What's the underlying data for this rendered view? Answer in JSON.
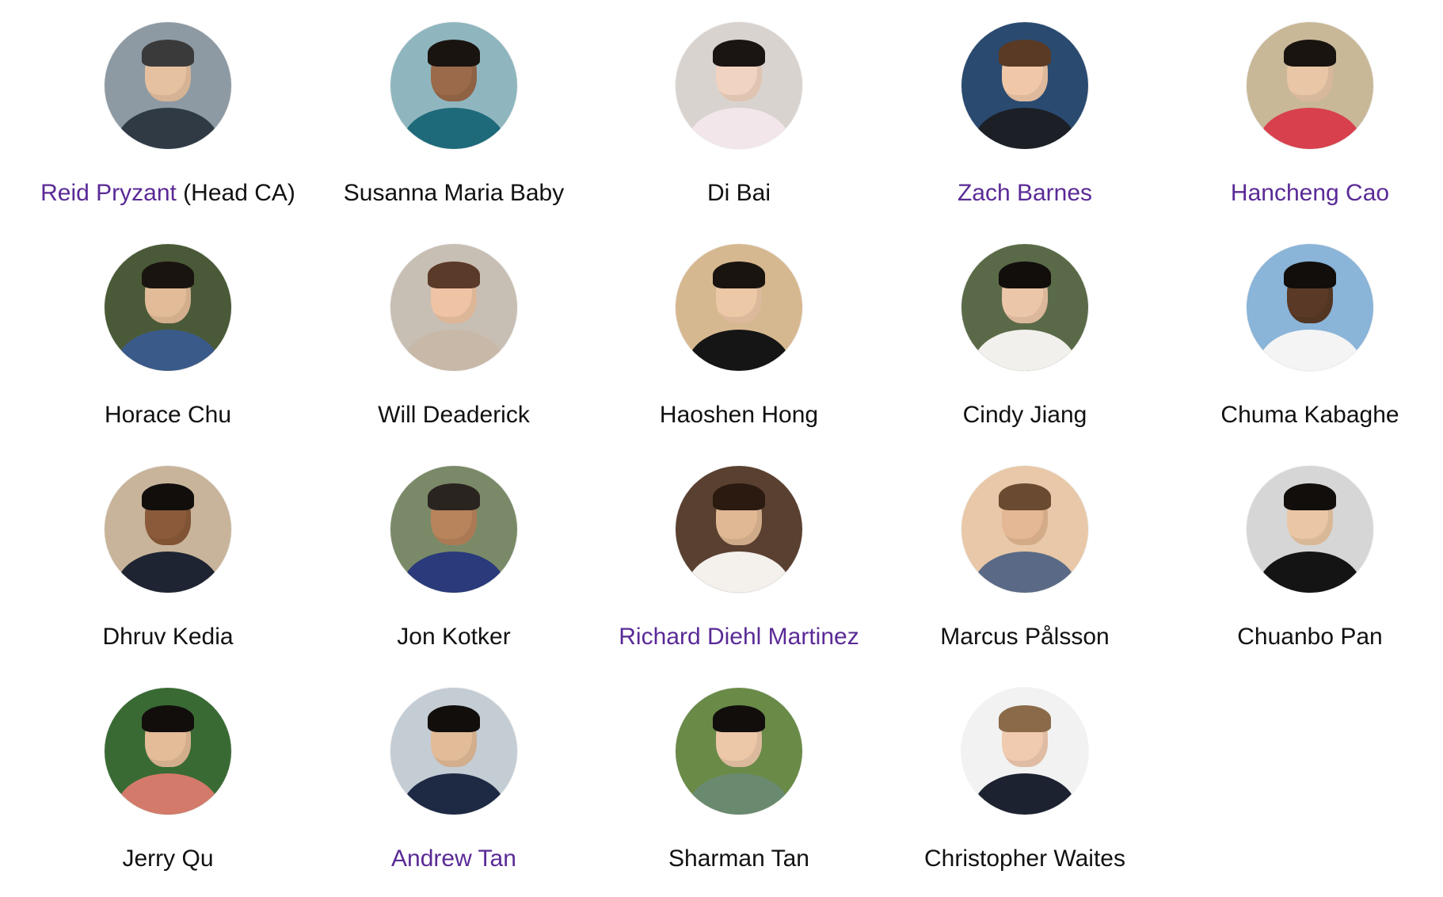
{
  "people": [
    {
      "name": "Reid Pryzant",
      "suffix": " (Head CA)",
      "linked": true,
      "colors": {
        "bg": "#8e9aa3",
        "skin": "#e6c1a0",
        "hair": "#3a3a3a",
        "body": "#2f3a44"
      }
    },
    {
      "name": "Susanna Maria Baby",
      "suffix": "",
      "linked": false,
      "colors": {
        "bg": "#8fb6bf",
        "skin": "#9a6a4a",
        "hair": "#1a1410",
        "body": "#1e6a7a"
      }
    },
    {
      "name": "Di Bai",
      "suffix": "",
      "linked": false,
      "colors": {
        "bg": "#d9d3cf",
        "skin": "#f0d3c0",
        "hair": "#1a1412",
        "body": "#f2e6ea"
      }
    },
    {
      "name": "Zach Barnes",
      "suffix": "",
      "linked": true,
      "colors": {
        "bg": "#2a4a70",
        "skin": "#f0c8a8",
        "hair": "#5a3a24",
        "body": "#1c2026"
      }
    },
    {
      "name": "Hancheng Cao",
      "suffix": "",
      "linked": true,
      "colors": {
        "bg": "#c9b898",
        "skin": "#e8c6a6",
        "hair": "#1a1410",
        "body": "#d8404e"
      }
    },
    {
      "name": "Horace Chu",
      "suffix": "",
      "linked": false,
      "colors": {
        "bg": "#4a5a38",
        "skin": "#e2bc98",
        "hair": "#1a1410",
        "body": "#3a5a8a"
      }
    },
    {
      "name": "Will Deaderick",
      "suffix": "",
      "linked": false,
      "colors": {
        "bg": "#c8bfb4",
        "skin": "#eec4a4",
        "hair": "#5a3a28",
        "body": "#c8b8a8"
      }
    },
    {
      "name": "Haoshen Hong",
      "suffix": "",
      "linked": false,
      "colors": {
        "bg": "#d6b890",
        "skin": "#ecc8a6",
        "hair": "#1a1410",
        "body": "#151515"
      }
    },
    {
      "name": "Cindy Jiang",
      "suffix": "",
      "linked": false,
      "colors": {
        "bg": "#5a6a48",
        "skin": "#ecc6a8",
        "hair": "#120e0c",
        "body": "#f2f0ec"
      }
    },
    {
      "name": "Chuma Kabaghe",
      "suffix": "",
      "linked": false,
      "colors": {
        "bg": "#8ab4d8",
        "skin": "#5a3a26",
        "hair": "#120e0c",
        "body": "#f4f4f4"
      }
    },
    {
      "name": "Dhruv Kedia",
      "suffix": "",
      "linked": false,
      "colors": {
        "bg": "#c8b49a",
        "skin": "#8a5a3a",
        "hair": "#120e0c",
        "body": "#1e2432"
      }
    },
    {
      "name": "Jon Kotker",
      "suffix": "",
      "linked": false,
      "colors": {
        "bg": "#7a8a68",
        "skin": "#b8845c",
        "hair": "#2a2420",
        "body": "#2a3a7a"
      }
    },
    {
      "name": "Richard Diehl Martinez",
      "suffix": "",
      "linked": true,
      "colors": {
        "bg": "#5a4030",
        "skin": "#e0b894",
        "hair": "#2a1a10",
        "body": "#f4f0ec"
      }
    },
    {
      "name": "Marcus Pålsson",
      "suffix": "",
      "linked": false,
      "colors": {
        "bg": "#e8c8a8",
        "skin": "#e4b894",
        "hair": "#6a4a30",
        "body": "#5a6a86"
      }
    },
    {
      "name": "Chuanbo Pan",
      "suffix": "",
      "linked": false,
      "colors": {
        "bg": "#d6d6d6",
        "skin": "#eac6a4",
        "hair": "#120e0c",
        "body": "#141414"
      }
    },
    {
      "name": "Jerry Qu",
      "suffix": "",
      "linked": false,
      "colors": {
        "bg": "#3a6a34",
        "skin": "#e4bc98",
        "hair": "#120e0c",
        "body": "#d47a6a"
      }
    },
    {
      "name": "Andrew Tan",
      "suffix": "",
      "linked": true,
      "colors": {
        "bg": "#c4ccd4",
        "skin": "#e2bc98",
        "hair": "#120e0c",
        "body": "#1e2a44"
      }
    },
    {
      "name": "Sharman Tan",
      "suffix": "",
      "linked": false,
      "colors": {
        "bg": "#6a8a48",
        "skin": "#ecc8a8",
        "hair": "#120e0c",
        "body": "#6a8a70"
      }
    },
    {
      "name": "Christopher Waites",
      "suffix": "",
      "linked": false,
      "colors": {
        "bg": "#f2f2f2",
        "skin": "#f0cbb0",
        "hair": "#8a6a48",
        "body": "#1c2230"
      }
    }
  ]
}
